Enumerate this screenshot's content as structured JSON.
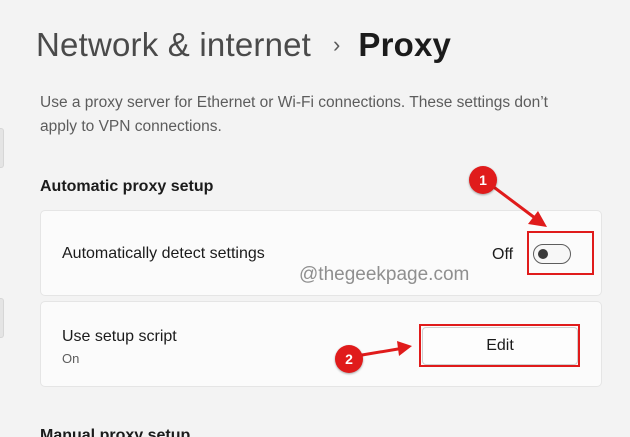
{
  "breadcrumb": {
    "parent": "Network & internet",
    "separator": "›",
    "current": "Proxy"
  },
  "description": "Use a proxy server for Ethernet or Wi-Fi connections. These settings don’t apply to VPN connections.",
  "automatic_proxy": {
    "heading": "Automatic proxy setup",
    "detect_settings": {
      "label": "Automatically detect settings",
      "state_label": "Off",
      "enabled": false
    },
    "setup_script": {
      "label": "Use setup script",
      "status": "On",
      "button_label": "Edit"
    }
  },
  "manual_proxy": {
    "heading": "Manual proxy setup"
  },
  "annotations": {
    "callout_1": "1",
    "callout_2": "2",
    "color": "#e01b1b"
  },
  "watermark": "@thegeekpage.com",
  "icons": {
    "breadcrumb_separator": "chevron-right-icon",
    "annotation_arrow": "arrow-icon"
  },
  "colors": {
    "background": "#f3f3f3",
    "card_background": "#fbfbfb",
    "annotation_red": "#e01b1b"
  }
}
